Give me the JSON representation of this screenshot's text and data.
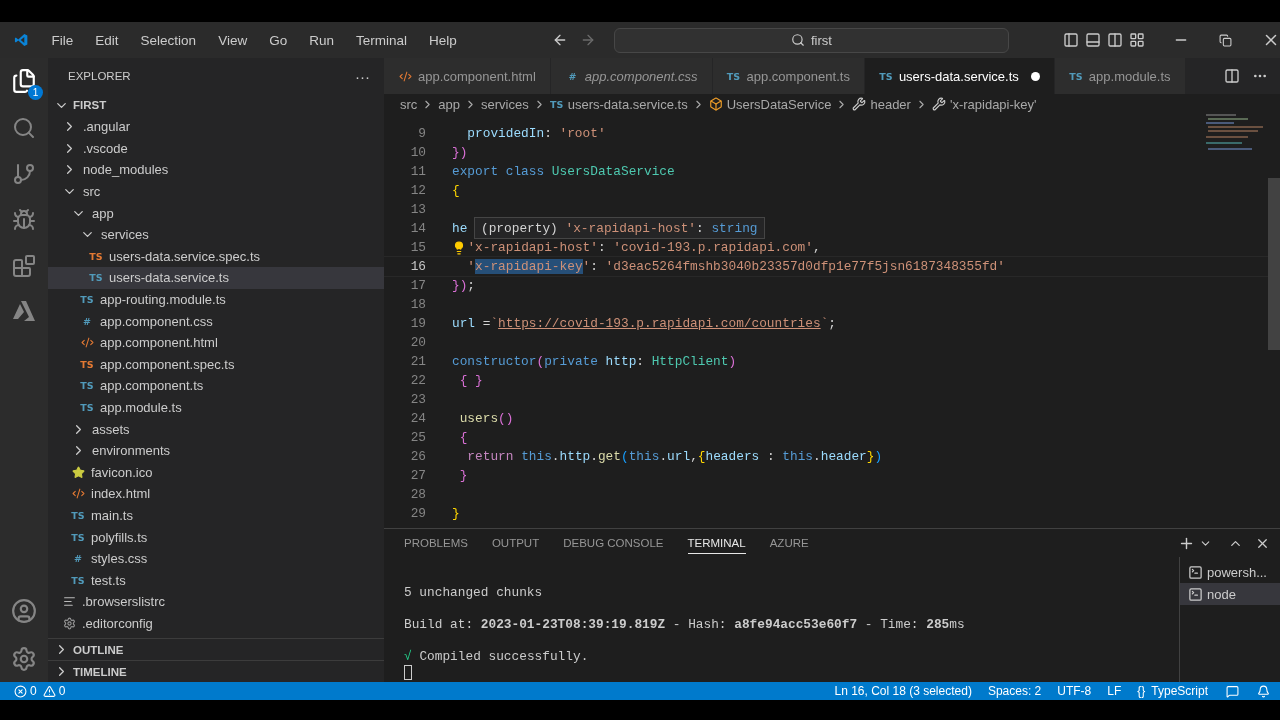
{
  "title_bar": {
    "menu": [
      "File",
      "Edit",
      "Selection",
      "View",
      "Go",
      "Run",
      "Terminal",
      "Help"
    ],
    "search": {
      "value": "first"
    }
  },
  "activity_bar": {
    "badge": "1"
  },
  "sidebar": {
    "title": "EXPLORER",
    "more": "···",
    "root": "FIRST",
    "tree": [
      {
        "label": ".angular",
        "kind": "folder",
        "expanded": false
      },
      {
        "label": ".vscode",
        "kind": "folder",
        "expanded": false
      },
      {
        "label": "node_modules",
        "kind": "folder",
        "expanded": false
      },
      {
        "label": "src",
        "kind": "folder",
        "expanded": true,
        "children": [
          {
            "label": "app",
            "kind": "folder",
            "expanded": true,
            "children": [
              {
                "label": "services",
                "kind": "folder",
                "expanded": true,
                "children": [
                  {
                    "label": "users-data.service.spec.ts",
                    "kind": "ts-spec",
                    "icon": "TS",
                    "selected": false
                  },
                  {
                    "label": "users-data.service.ts",
                    "kind": "ts",
                    "icon": "TS",
                    "selected": true
                  }
                ]
              },
              {
                "label": "app-routing.module.ts",
                "kind": "ts",
                "icon": "TS",
                "selected": false
              },
              {
                "label": "app.component.css",
                "kind": "css",
                "icon": "#",
                "selected": false
              },
              {
                "label": "app.component.html",
                "kind": "html",
                "selected": false
              },
              {
                "label": "app.component.spec.ts",
                "kind": "ts-spec",
                "icon": "TS",
                "selected": false
              },
              {
                "label": "app.component.ts",
                "kind": "ts",
                "icon": "TS",
                "selected": false
              },
              {
                "label": "app.module.ts",
                "kind": "ts",
                "icon": "TS",
                "selected": false
              }
            ]
          },
          {
            "label": "assets",
            "kind": "folder",
            "expanded": false
          },
          {
            "label": "environments",
            "kind": "folder",
            "expanded": false
          },
          {
            "label": "favicon.ico",
            "kind": "ico",
            "selected": false
          },
          {
            "label": "index.html",
            "kind": "html",
            "selected": false
          },
          {
            "label": "main.ts",
            "kind": "ts",
            "icon": "TS",
            "selected": false
          },
          {
            "label": "polyfills.ts",
            "kind": "ts",
            "icon": "TS",
            "selected": false
          },
          {
            "label": "styles.css",
            "kind": "css",
            "icon": "#",
            "selected": false
          },
          {
            "label": "test.ts",
            "kind": "ts",
            "icon": "TS",
            "selected": false
          }
        ]
      },
      {
        "label": ".browserslistrc",
        "kind": "config",
        "selected": false
      },
      {
        "label": ".editorconfig",
        "kind": "gear",
        "selected": false
      }
    ],
    "sections": [
      "OUTLINE",
      "TIMELINE"
    ]
  },
  "tabs": [
    {
      "label": "app.component.html",
      "kind": "html",
      "selected": false,
      "preview": false
    },
    {
      "label": "app.component.css",
      "kind": "css",
      "icon": "#",
      "selected": false,
      "preview": true
    },
    {
      "label": "app.component.ts",
      "kind": "ts",
      "icon": "TS",
      "selected": false,
      "preview": false
    },
    {
      "label": "users-data.service.ts",
      "kind": "ts",
      "icon": "TS",
      "selected": true,
      "preview": false,
      "modified": true
    },
    {
      "label": "app.module.ts",
      "kind": "ts",
      "icon": "TS",
      "selected": false,
      "preview": false
    }
  ],
  "breadcrumbs": [
    {
      "label": "src",
      "kind": "folder"
    },
    {
      "label": "app",
      "kind": "folder"
    },
    {
      "label": "services",
      "kind": "folder"
    },
    {
      "label": "users-data.service.ts",
      "kind": "ts",
      "icon": "TS"
    },
    {
      "label": "UsersDataService",
      "kind": "class"
    },
    {
      "label": "header",
      "kind": "property"
    },
    {
      "label": "'x-rapidapi-key'",
      "kind": "property"
    }
  ],
  "code": [
    {
      "n": "9",
      "tokens": [
        {
          "t": "  providedIn",
          "kind": "prop"
        },
        {
          "t": ": ",
          "kind": "punct"
        },
        {
          "t": "'root'",
          "kind": "string"
        }
      ]
    },
    {
      "n": "10",
      "tokens": [
        {
          "t": "})",
          "kind": "bracket2"
        }
      ]
    },
    {
      "n": "11",
      "tokens": [
        {
          "t": "export ",
          "kind": "keyword"
        },
        {
          "t": "class ",
          "kind": "keyword"
        },
        {
          "t": "UsersDataService",
          "kind": "class"
        }
      ]
    },
    {
      "n": "12",
      "tokens": [
        {
          "t": "{",
          "kind": "bracket1"
        }
      ]
    },
    {
      "n": "13"
    },
    {
      "n": "14",
      "tokens": [
        {
          "t": "he",
          "kind": "prop"
        }
      ],
      "hover": {
        "label": "(property)",
        "name": "'x-rapidapi-host'",
        "sep": ":",
        "type": "string"
      }
    },
    {
      "n": "15",
      "lightbulb": true,
      "tokens": [
        {
          "t": "'x-rapidapi-host'",
          "kind": "string"
        },
        {
          "t": ": ",
          "kind": "punct"
        },
        {
          "t": "'covid-193.p.rapidapi.com'",
          "kind": "string"
        },
        {
          "t": ",",
          "kind": "punct"
        }
      ]
    },
    {
      "n": "16",
      "current": true,
      "tokens": [
        {
          "t": "  '",
          "kind": "string"
        },
        {
          "t": "x-rapidapi-key",
          "kind": "string",
          "highlight": true
        },
        {
          "t": "'",
          "kind": "string"
        },
        {
          "t": ": ",
          "kind": "punct"
        },
        {
          "t": "'d3eac5264fmshb3040b23357d0dfp1e77f5jsn6187348355fd'",
          "kind": "string"
        }
      ]
    },
    {
      "n": "17",
      "tokens": [
        {
          "t": "})",
          "kind": "bracket2"
        },
        {
          "t": ";",
          "kind": "punct"
        }
      ]
    },
    {
      "n": "18"
    },
    {
      "n": "19",
      "tokens": [
        {
          "t": "url",
          "kind": "prop"
        },
        {
          "t": " =",
          "kind": "punct"
        },
        {
          "t": "`",
          "kind": "string"
        },
        {
          "t": "https://covid-193.p.rapidapi.com/countries",
          "kind": "link"
        },
        {
          "t": "`",
          "kind": "string"
        },
        {
          "t": ";",
          "kind": "punct"
        }
      ]
    },
    {
      "n": "20"
    },
    {
      "n": "21",
      "tokens": [
        {
          "t": "constructor",
          "kind": "keyword"
        },
        {
          "t": "(",
          "kind": "bracket2"
        },
        {
          "t": "private ",
          "kind": "keyword"
        },
        {
          "t": "http",
          "kind": "prop"
        },
        {
          "t": ": ",
          "kind": "punct"
        },
        {
          "t": "HttpClient",
          "kind": "class"
        },
        {
          "t": ")",
          "kind": "bracket2"
        }
      ]
    },
    {
      "n": "22",
      "tokens": [
        {
          "t": " { }",
          "kind": "bracket2"
        }
      ]
    },
    {
      "n": "23"
    },
    {
      "n": "24",
      "tokens": [
        {
          "t": " users",
          "kind": "function"
        },
        {
          "t": "()",
          "kind": "bracket2"
        }
      ]
    },
    {
      "n": "25",
      "tokens": [
        {
          "t": " {",
          "kind": "bracket2"
        }
      ]
    },
    {
      "n": "26",
      "tokens": [
        {
          "t": "  return ",
          "kind": "control"
        },
        {
          "t": "this",
          "kind": "keyword"
        },
        {
          "t": ".",
          "kind": "punct"
        },
        {
          "t": "http",
          "kind": "prop"
        },
        {
          "t": ".",
          "kind": "punct"
        },
        {
          "t": "get",
          "kind": "function"
        },
        {
          "t": "(",
          "kind": "bracket3"
        },
        {
          "t": "this",
          "kind": "keyword"
        },
        {
          "t": ".",
          "kind": "punct"
        },
        {
          "t": "url",
          "kind": "prop"
        },
        {
          "t": ",",
          "kind": "punct"
        },
        {
          "t": "{",
          "kind": "bracket1"
        },
        {
          "t": "headers",
          "kind": "prop"
        },
        {
          "t": " : ",
          "kind": "punct"
        },
        {
          "t": "this",
          "kind": "keyword"
        },
        {
          "t": ".",
          "kind": "punct"
        },
        {
          "t": "header",
          "kind": "prop"
        },
        {
          "t": "}",
          "kind": "bracket1"
        },
        {
          "t": ")",
          "kind": "bracket3"
        }
      ]
    },
    {
      "n": "27",
      "tokens": [
        {
          "t": " }",
          "kind": "bracket2"
        }
      ]
    },
    {
      "n": "28"
    },
    {
      "n": "29",
      "tokens": [
        {
          "t": "}",
          "kind": "bracket1"
        }
      ]
    }
  ],
  "panel": {
    "tabs": [
      {
        "label": "PROBLEMS",
        "selected": false
      },
      {
        "label": "OUTPUT",
        "selected": false
      },
      {
        "label": "DEBUG CONSOLE",
        "selected": false
      },
      {
        "label": "TERMINAL",
        "selected": true
      },
      {
        "label": "AZURE",
        "selected": false
      }
    ],
    "terminal_lines": [
      {
        "text": "5 unchanged chunks"
      },
      {
        "text": "Build at: **2023-01-23T08:39:19.819Z** - Hash: **a8fe94acc53e60f7** - Time: **285**ms"
      },
      {
        "mark": "√",
        "text": "Compiled successfully."
      }
    ],
    "terminals": [
      {
        "label": "powersh...",
        "selected": false
      },
      {
        "label": "node",
        "selected": true
      }
    ]
  },
  "status_bar": {
    "errors": "0",
    "warnings": "0",
    "items": [
      {
        "label": "Ln 16, Col 18 (3 selected)"
      },
      {
        "label": "Spaces: 2"
      },
      {
        "label": "UTF-8"
      },
      {
        "label": "LF"
      },
      {
        "icon": "{}",
        "label": "TypeScript"
      }
    ]
  }
}
